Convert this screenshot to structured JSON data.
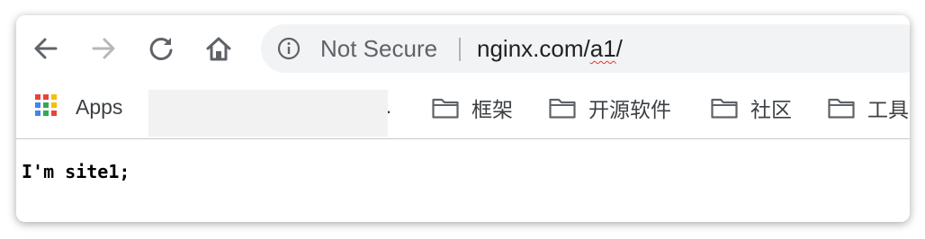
{
  "toolbar": {
    "back_icon": "arrow-left-icon",
    "forward_icon": "arrow-right-icon",
    "reload_icon": "reload-icon",
    "home_icon": "home-icon"
  },
  "omnibox": {
    "info_icon": "info-circle-icon",
    "security_status": "Not Secure",
    "url_host": "nginx.com/",
    "url_path": "a1",
    "url_trailing": "/"
  },
  "bookmarks": {
    "apps_label": "Apps",
    "blurred_suffix": ".",
    "folders": [
      "框架",
      "开源软件",
      "社区",
      "工具"
    ]
  },
  "page": {
    "body_text": "I'm site1;"
  },
  "colors": {
    "toolbar_icon": "#5f6368",
    "forward_disabled": "#b7b7b7",
    "omnibox_bg": "#f1f3f4",
    "spellcheck_underline": "#e53935"
  }
}
